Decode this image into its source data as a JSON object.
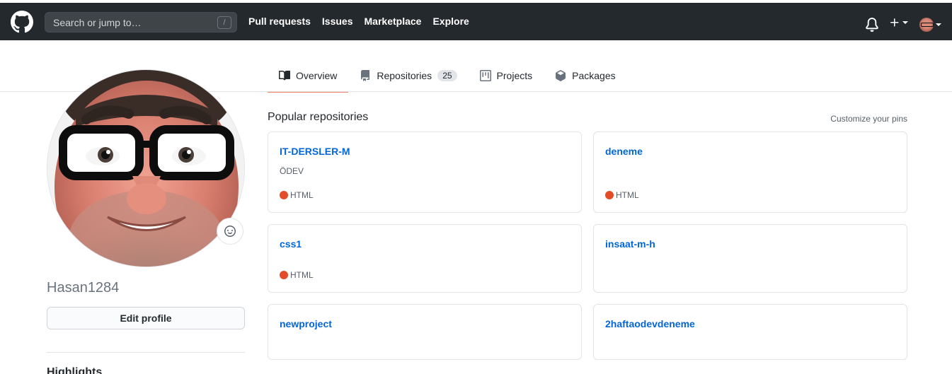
{
  "header": {
    "search_placeholder": "Search or jump to…",
    "search_shortcut": "/",
    "nav": [
      "Pull requests",
      "Issues",
      "Marketplace",
      "Explore"
    ]
  },
  "tabs": [
    {
      "label": "Overview",
      "active": true
    },
    {
      "label": "Repositories",
      "count": "25"
    },
    {
      "label": "Projects"
    },
    {
      "label": "Packages"
    }
  ],
  "profile": {
    "username": "Hasan1284",
    "edit_label": "Edit profile",
    "highlights_label": "Highlights"
  },
  "pinned": {
    "title": "Popular repositories",
    "customize_label": "Customize your pins",
    "repos": [
      {
        "name": "IT-DERSLER-M",
        "description": "ÖDEV",
        "language": "HTML"
      },
      {
        "name": "deneme",
        "description": "",
        "language": "HTML"
      },
      {
        "name": "css1",
        "description": "",
        "language": "HTML"
      },
      {
        "name": "insaat-m-h",
        "description": "",
        "language": ""
      },
      {
        "name": "newproject",
        "description": "",
        "language": ""
      },
      {
        "name": "2haftaodevdeneme",
        "description": "",
        "language": ""
      }
    ]
  },
  "colors": {
    "header_bg": "#24292e",
    "link": "#0366d6",
    "active_tab_underline": "#f9826c",
    "html_language": "#e34c26"
  }
}
